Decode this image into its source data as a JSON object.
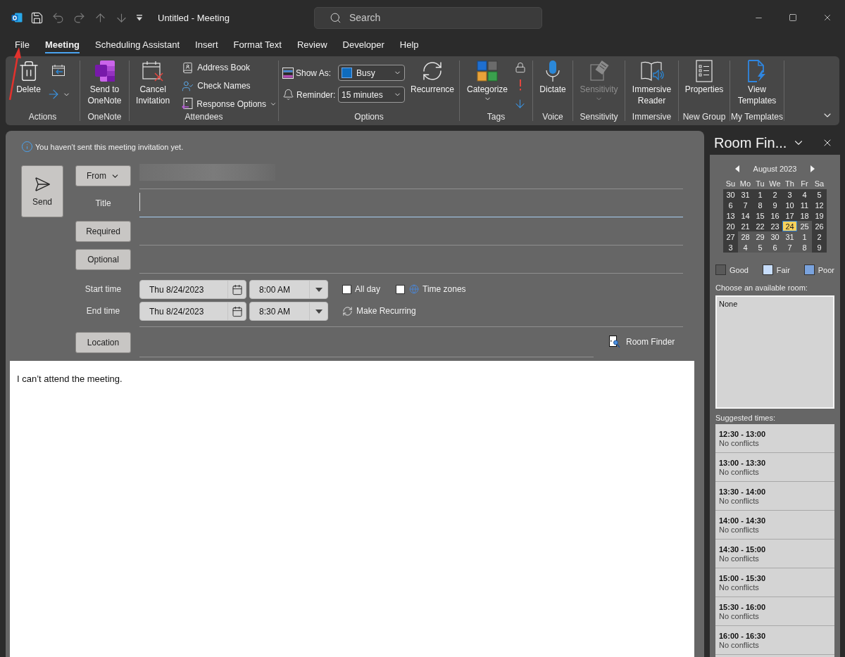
{
  "title_bar": {
    "title": "Untitled - Meeting",
    "search": {
      "placeholder": "Search"
    }
  },
  "tabs": [
    {
      "label": "File",
      "selected": false
    },
    {
      "label": "Meeting",
      "selected": true
    },
    {
      "label": "Scheduling Assistant",
      "selected": false
    },
    {
      "label": "Insert",
      "selected": false
    },
    {
      "label": "Format Text",
      "selected": false
    },
    {
      "label": "Review",
      "selected": false
    },
    {
      "label": "Developer",
      "selected": false
    },
    {
      "label": "Help",
      "selected": false
    }
  ],
  "ribbon": {
    "groups": [
      {
        "label": "Actions",
        "items": [
          {
            "kind": "large",
            "label": "Delete",
            "menu": false,
            "disabled": false
          },
          {
            "kind": "icon_stack"
          }
        ]
      },
      {
        "label": "OneNote",
        "items": [
          {
            "kind": "large",
            "label": "Send to OneNote",
            "menu": false,
            "disabled": false
          }
        ]
      },
      {
        "label": "Attendees",
        "items": [
          {
            "kind": "large",
            "label": "Cancel Invitation",
            "menu": false,
            "disabled": false
          },
          {
            "kind": "stack",
            "buttons": [
              {
                "label": "Address Book",
                "menu": false
              },
              {
                "label": "Check Names",
                "menu": false
              },
              {
                "label": "Response Options",
                "menu": true
              }
            ]
          }
        ]
      },
      {
        "label": "Options",
        "items": [
          {
            "kind": "select_stack",
            "rows": [
              {
                "label": "Show As:",
                "value": "Busy"
              },
              {
                "label": "Reminder:",
                "value": "15 minutes"
              }
            ]
          },
          {
            "kind": "large",
            "label": "Recurrence",
            "menu": false,
            "disabled": false
          }
        ]
      },
      {
        "label": "Tags",
        "items": [
          {
            "kind": "large",
            "label": "Categorize",
            "menu": true,
            "disabled": false
          },
          {
            "kind": "icon_stack"
          }
        ]
      },
      {
        "label": "Voice",
        "items": [
          {
            "kind": "large",
            "label": "Dictate",
            "menu": false,
            "disabled": false
          }
        ]
      },
      {
        "label": "Sensitivity",
        "items": [
          {
            "kind": "large",
            "label": "Sensitivity",
            "menu": true,
            "disabled": true
          }
        ]
      },
      {
        "label": "Immersive",
        "items": [
          {
            "kind": "large",
            "label": "Immersive Reader",
            "menu": false,
            "disabled": false
          }
        ]
      },
      {
        "label": "New Group",
        "items": [
          {
            "kind": "large",
            "label": "Properties",
            "menu": false,
            "disabled": false
          }
        ]
      },
      {
        "label": "My Templates",
        "items": [
          {
            "kind": "large",
            "label": "View Templates",
            "menu": false,
            "disabled": false
          }
        ]
      }
    ]
  },
  "form": {
    "notice": "You haven't sent this meeting invitation yet.",
    "send": {
      "label": "Send"
    },
    "from": {
      "button": "From"
    },
    "title": {
      "label": "Title"
    },
    "required": {
      "button": "Required"
    },
    "optional": {
      "button": "Optional"
    },
    "start": {
      "label": "Start time",
      "date": "Thu 8/24/2023",
      "time": "8:00 AM"
    },
    "end": {
      "label": "End time",
      "date": "Thu 8/24/2023",
      "time": "8:30 AM"
    },
    "all_day": {
      "label": "All day",
      "checked": false
    },
    "time_zones": {
      "label": "Time zones",
      "checked": false
    },
    "make_recurring": {
      "label": "Make Recurring"
    },
    "location": {
      "button": "Location"
    },
    "room_finder": {
      "label": "Room Finder"
    }
  },
  "body": {
    "text": "I can’t attend the meeting."
  },
  "room_finder_pane": {
    "title": "Room Fin...",
    "calendar": {
      "month": "August 2023",
      "weekdays": [
        "Su",
        "Mo",
        "Tu",
        "We",
        "Th",
        "Fr",
        "Sa"
      ],
      "weeks": [
        [
          {
            "day": "30",
            "good": false,
            "selected": false
          },
          {
            "day": "31",
            "good": false,
            "selected": false
          },
          {
            "day": "1",
            "good": false,
            "selected": false
          },
          {
            "day": "2",
            "good": false,
            "selected": false
          },
          {
            "day": "3",
            "good": false,
            "selected": false
          },
          {
            "day": "4",
            "good": false,
            "selected": false
          },
          {
            "day": "5",
            "good": false,
            "selected": false
          }
        ],
        [
          {
            "day": "6",
            "good": false,
            "selected": false
          },
          {
            "day": "7",
            "good": false,
            "selected": false
          },
          {
            "day": "8",
            "good": false,
            "selected": false
          },
          {
            "day": "9",
            "good": false,
            "selected": false
          },
          {
            "day": "10",
            "good": false,
            "selected": false
          },
          {
            "day": "11",
            "good": false,
            "selected": false
          },
          {
            "day": "12",
            "good": false,
            "selected": false
          }
        ],
        [
          {
            "day": "13",
            "good": false,
            "selected": false
          },
          {
            "day": "14",
            "good": false,
            "selected": false
          },
          {
            "day": "15",
            "good": false,
            "selected": false
          },
          {
            "day": "16",
            "good": false,
            "selected": false
          },
          {
            "day": "17",
            "good": false,
            "selected": false
          },
          {
            "day": "18",
            "good": false,
            "selected": false
          },
          {
            "day": "19",
            "good": false,
            "selected": false
          }
        ],
        [
          {
            "day": "20",
            "good": false,
            "selected": false
          },
          {
            "day": "21",
            "good": false,
            "selected": false
          },
          {
            "day": "22",
            "good": false,
            "selected": false
          },
          {
            "day": "23",
            "good": false,
            "selected": false
          },
          {
            "day": "24",
            "good": false,
            "selected": true
          },
          {
            "day": "25",
            "good": true,
            "selected": false
          },
          {
            "day": "26",
            "good": false,
            "selected": false
          }
        ],
        [
          {
            "day": "27",
            "good": false,
            "selected": false
          },
          {
            "day": "28",
            "good": true,
            "selected": false
          },
          {
            "day": "29",
            "good": true,
            "selected": false
          },
          {
            "day": "30",
            "good": true,
            "selected": false
          },
          {
            "day": "31",
            "good": true,
            "selected": false
          },
          {
            "day": "1",
            "good": true,
            "selected": false
          },
          {
            "day": "2",
            "good": false,
            "selected": false
          }
        ],
        [
          {
            "day": "3",
            "good": false,
            "selected": false
          },
          {
            "day": "4",
            "good": true,
            "selected": false
          },
          {
            "day": "5",
            "good": true,
            "selected": false
          },
          {
            "day": "6",
            "good": true,
            "selected": false
          },
          {
            "day": "7",
            "good": true,
            "selected": false
          },
          {
            "day": "8",
            "good": true,
            "selected": false
          },
          {
            "day": "9",
            "good": false,
            "selected": false
          }
        ]
      ]
    },
    "legend": [
      {
        "label": "Good",
        "color": "#595959"
      },
      {
        "label": "Fair",
        "color": "#c7ddfb"
      },
      {
        "label": "Poor",
        "color": "#7aa3de"
      }
    ],
    "rooms": {
      "label": "Choose an available room:",
      "items": [
        "None"
      ]
    },
    "suggested": {
      "label": "Suggested times:",
      "items": [
        {
          "time": "12:30 - 13:00",
          "status": "No conflicts"
        },
        {
          "time": "13:00 - 13:30",
          "status": "No conflicts"
        },
        {
          "time": "13:30 - 14:00",
          "status": "No conflicts"
        },
        {
          "time": "14:00 - 14:30",
          "status": "No conflicts"
        },
        {
          "time": "14:30 - 15:00",
          "status": "No conflicts"
        },
        {
          "time": "15:00 - 15:30",
          "status": "No conflicts"
        },
        {
          "time": "15:30 - 16:00",
          "status": "No conflicts"
        },
        {
          "time": "16:00 - 16:30",
          "status": "No conflicts"
        }
      ]
    }
  }
}
